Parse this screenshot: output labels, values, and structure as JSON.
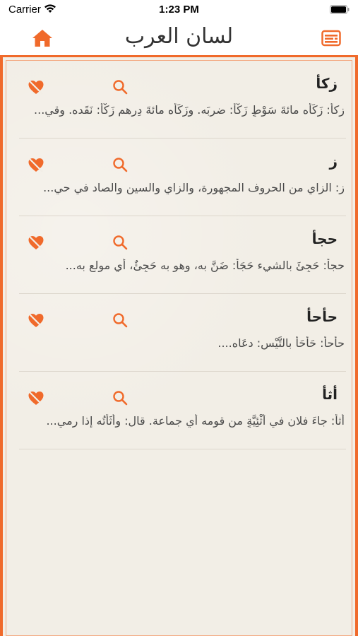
{
  "status_bar": {
    "carrier": "Carrier",
    "time": "1:23 PM"
  },
  "nav": {
    "title": "لسان العرب",
    "home_icon": "home-icon",
    "menu_icon": "card-list-icon"
  },
  "colors": {
    "accent": "#f06a2b",
    "background": "#f2eee6",
    "text": "#222222"
  },
  "entries": [
    {
      "headword": "زكأ",
      "snippet": "زكأ: زَكَأَه مائةَ سَوْطٍ زَكْأً: ضربَه. وزَكَأَه مائةَ دِرهم زَكْأً: نَقَده. وقي..."
    },
    {
      "headword": "ز",
      "snippet": "ز: الزاي من الحروف المجهورة، والزاي والسين والصاد في حي..."
    },
    {
      "headword": "حجأ",
      "snippet": "حجأ: حَجِئَ بالشيء حَجَأً: ضَنَّ به، وهو به حَجِئٌ، أي مولع به..."
    },
    {
      "headword": "حأحأ",
      "snippet": "حأحأ: حَأْحَأَ بالتَّيْس: دعَاه...."
    },
    {
      "headword": "أثأ",
      "snippet": "أثأ: جاءَ فلان في أُثْئِيَّةٍ من قومه أي جماعة. قال: وأَثَأْتُه إذا رمي..."
    }
  ]
}
